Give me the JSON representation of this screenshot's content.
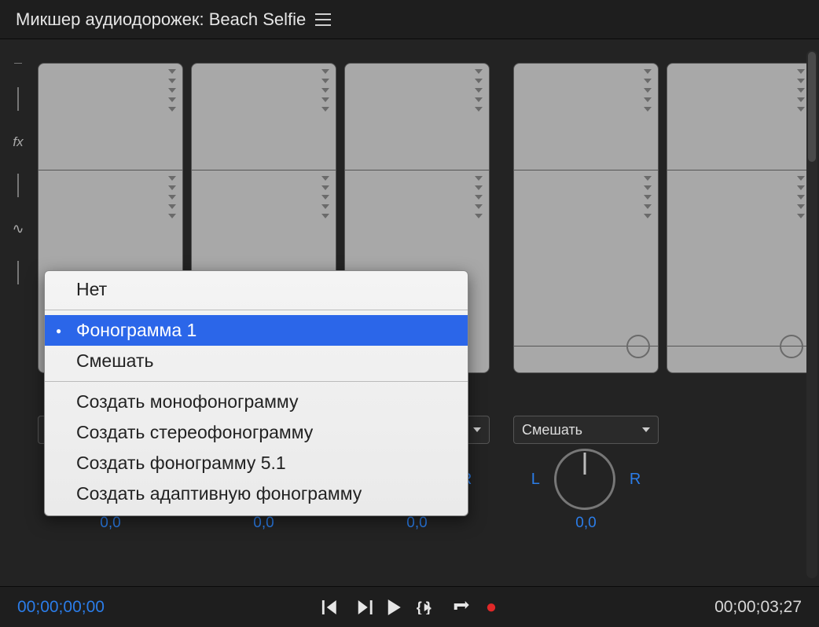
{
  "header": {
    "title": "Микшер аудиодорожек: Beach Selfie"
  },
  "effect_slot_label": "Фонограмма",
  "tracks": [
    {
      "assign": "",
      "pan": "0,0"
    },
    {
      "assign": "",
      "pan": "0,0"
    },
    {
      "assign": "",
      "pan": "0,0"
    },
    {
      "assign": "Смешать",
      "pan": "0,0"
    },
    {
      "assign": "",
      "pan": ""
    }
  ],
  "pan_labels": {
    "left": "L",
    "right": "R"
  },
  "dropdown": {
    "items_top": [
      "Нет"
    ],
    "items_mid": [
      "Фонограмма 1",
      "Смешать"
    ],
    "selected_index": 0,
    "items_bottom": [
      "Создать монофонограмму",
      "Создать стереофонограмму",
      "Создать фонограмму 5.1",
      "Создать адаптивную фонограмму"
    ]
  },
  "transport": {
    "current": "00;00;00;00",
    "duration": "00;00;03;27"
  }
}
